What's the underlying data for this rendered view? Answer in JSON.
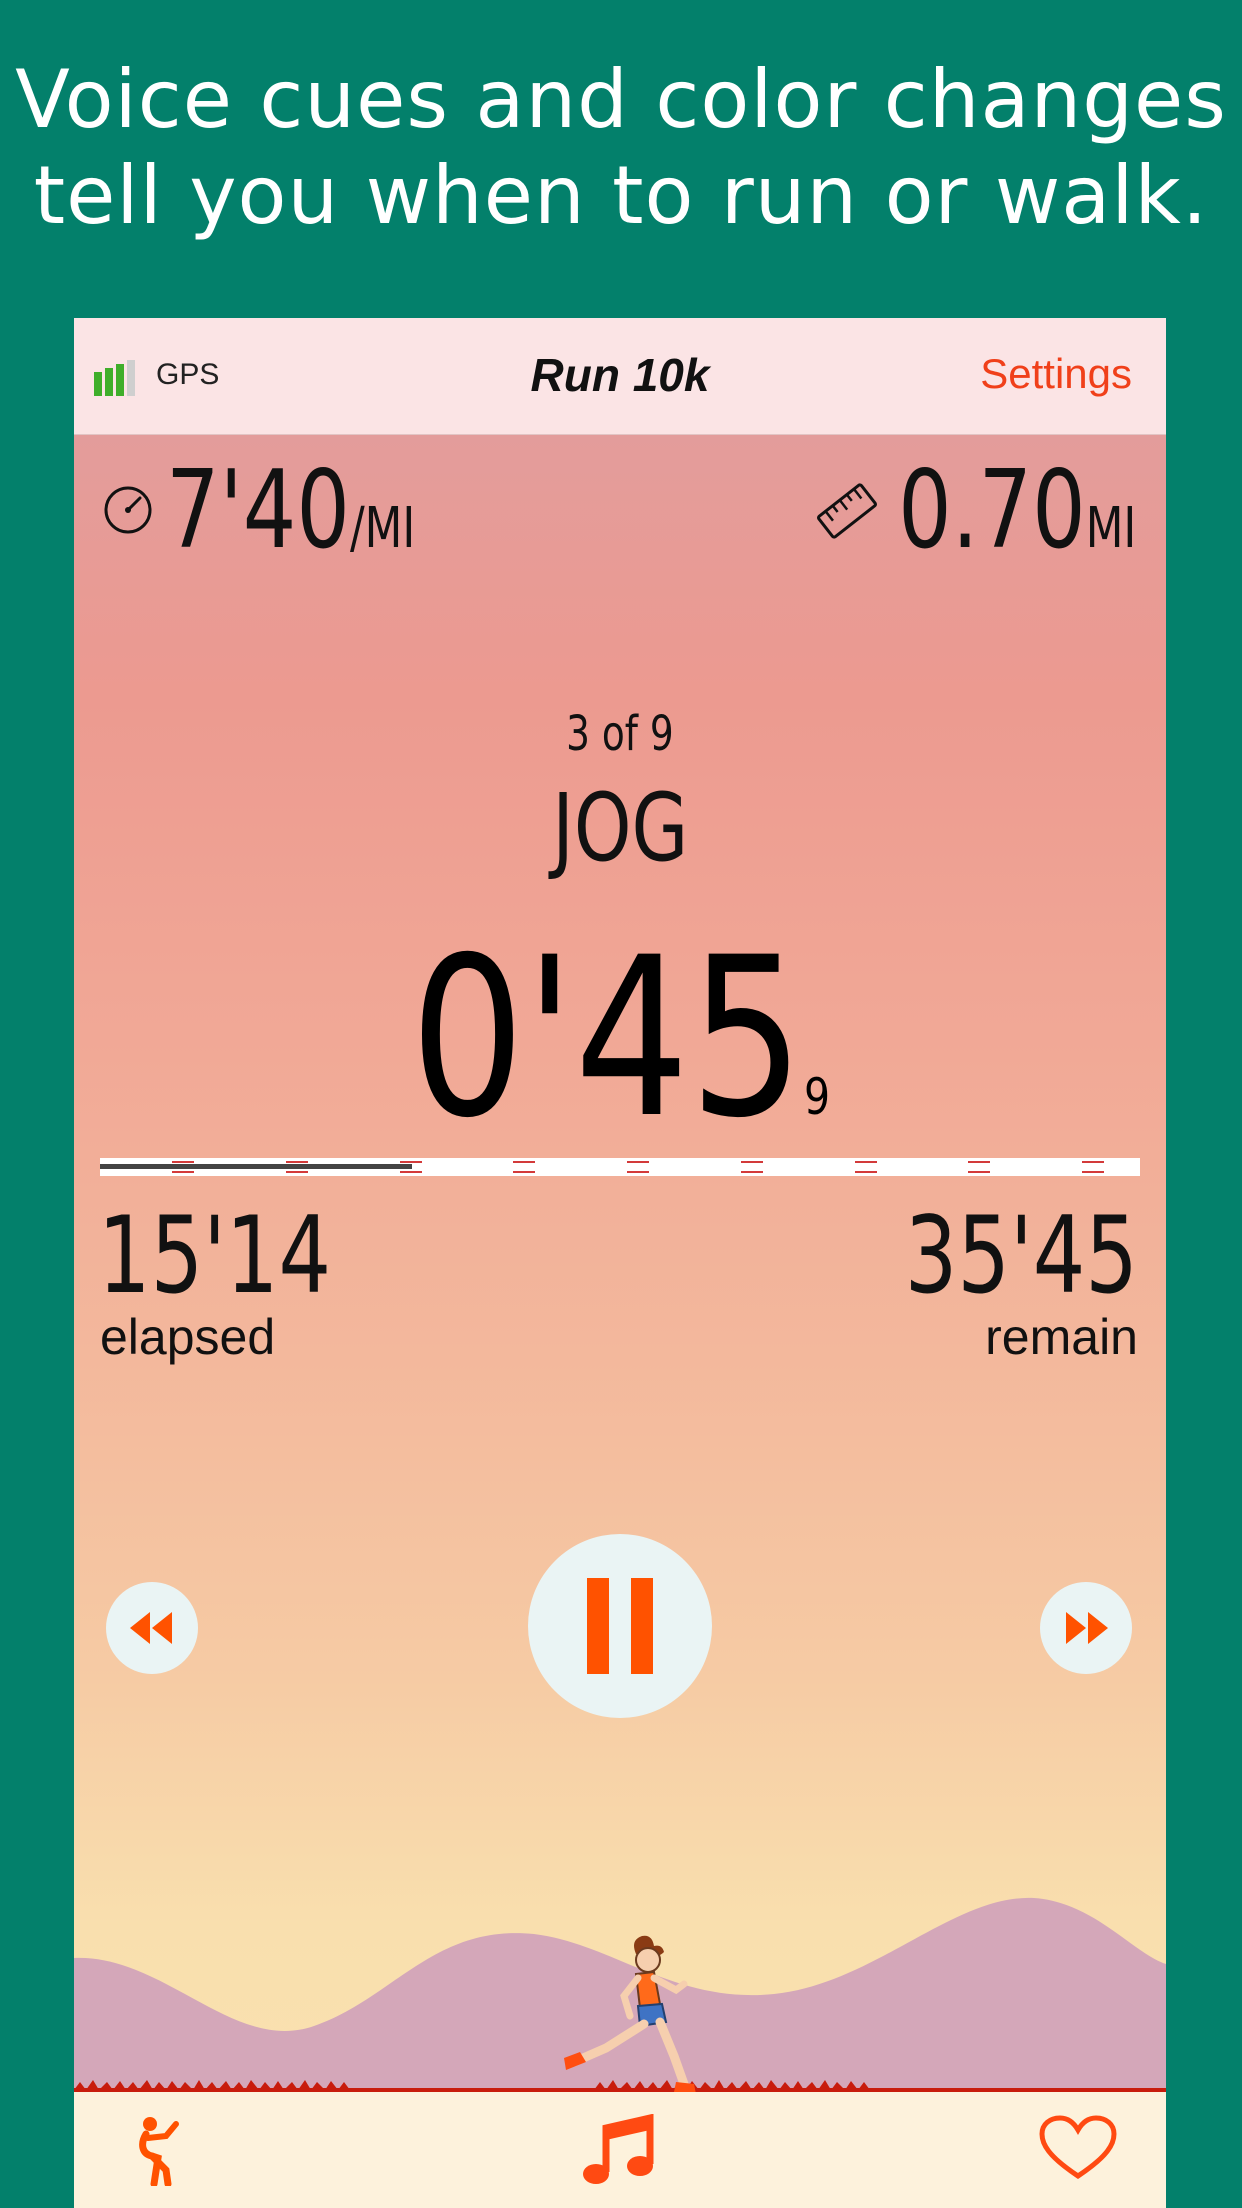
{
  "headline": {
    "line1": "Voice cues and color changes",
    "line2": "tell you when to run or walk."
  },
  "navbar": {
    "signal_icon": "signal-bars-icon",
    "gps_label": "GPS",
    "title": "Run 10k",
    "settings_label": "Settings"
  },
  "stats": {
    "pace_icon": "speedometer-icon",
    "pace_value": "7'40",
    "pace_unit": "/MI",
    "distance_icon": "ruler-icon",
    "distance_value": "0.70",
    "distance_unit": "MI"
  },
  "interval": {
    "count": "3 of 9",
    "name": "JOG",
    "time": "0'45",
    "tenths": "9"
  },
  "progress": {
    "fraction": 0.3,
    "segments": 9,
    "completed": 3
  },
  "totals": {
    "elapsed_value": "15'14",
    "elapsed_label": "elapsed",
    "remain_value": "35'45",
    "remain_label": "remain"
  },
  "controls": {
    "back_icon": "rewind-icon",
    "pause_icon": "pause-icon",
    "forward_icon": "fast-forward-icon"
  },
  "tabbar": {
    "left_icon": "stretching-figure-icon",
    "center_icon": "music-note-icon",
    "right_icon": "heart-icon"
  },
  "colors": {
    "background": "#03806b",
    "accent": "#f0401a",
    "control_orange": "#ff5200",
    "navbar_bg": "#fbe4e5",
    "tabbar_bg": "#fdf2dc"
  }
}
